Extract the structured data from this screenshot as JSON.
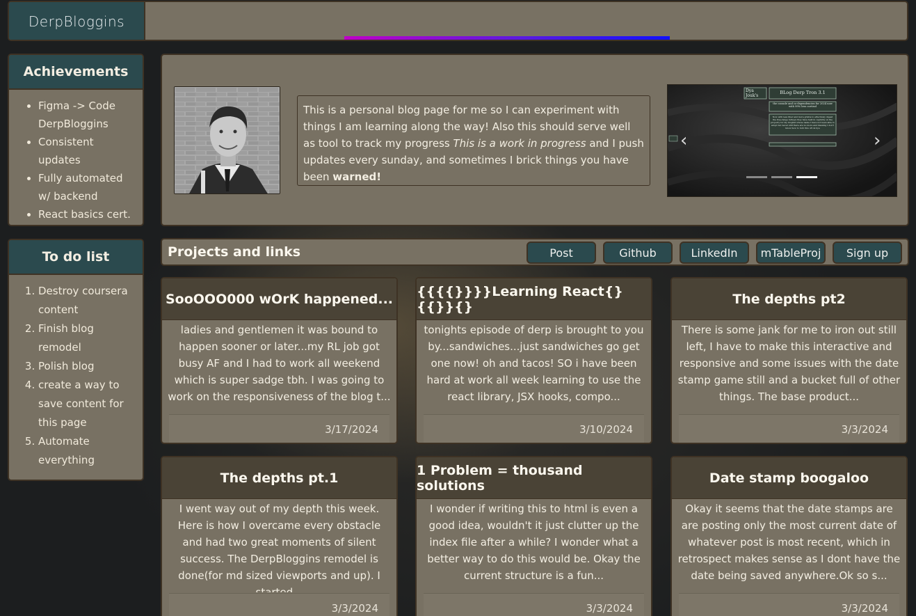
{
  "header": {
    "logo": "DerpBloggins",
    "progress": 1.0,
    "progress_gradient": [
      "#c000c8",
      "#1010ff"
    ]
  },
  "achievements": {
    "title": "Achievements",
    "items": [
      "Figma -> Code DerpBloggins",
      "Consistent updates",
      "Fully automated w/ backend",
      "React basics cert."
    ]
  },
  "todo": {
    "title": "To do list",
    "items": [
      "Destroy coursera content",
      "Finish blog remodel",
      "Polish blog",
      "create a way to save content for this page",
      "Automate everything"
    ]
  },
  "intro": {
    "text_part1": "This is a personal blog page for me so I can experiment with things I am learning along the way! Also this should serve well as tool to track my progress ",
    "text_italic": "This is a work in progress",
    "text_part2": " and I push updates every sunday, and sometimes I brick things you have been ",
    "text_bold": "warned!"
  },
  "carousel": {
    "slide_logo_line1": "Dya",
    "slide_logo_line2": "Jouk's",
    "slide_title": "BLog Derp Tron 3.1",
    "slide_subtitle": "the console and co-dependencies for 2024 now with 99% less cortisol",
    "slide_body": "Now with less fiber and more gristle to effectively digest the free-range turkeys they have held in captivity on the property for my bloglist whose name I have not been able to adopt but never still there are no more and blessing I don't know how to turn this off ok bye",
    "indicators": 3,
    "active_index": 2
  },
  "projects": {
    "title": "Projects and links",
    "nav": [
      "Post",
      "Github",
      "LinkedIn",
      "mTableProj",
      "Sign up"
    ]
  },
  "posts": [
    {
      "title": "SooOOO000 wOrK happened...",
      "excerpt": "ladies and gentlemen it was bound to happen sooner or later...my RL job got busy AF and I had to work all weekend which is super sadge tbh. I was going to work on the responsiveness of the blog t...",
      "date": "3/17/2024"
    },
    {
      "title": "{{{{}}}}Learning React{}{{}}{}",
      "excerpt": "tonights episode of derp is brought to you by...sandwiches...just sandwiches go get one now! oh and tacos! SO i have been hard at work all week learning to use the react library, JSX hooks, compo...",
      "date": "3/10/2024"
    },
    {
      "title": "The depths pt2",
      "excerpt": "There is some jank for me to iron out still left, I have to make this interactive and responsive and some issues with the date stamp game still and a bucket full of other things. The base product...",
      "date": "3/3/2024"
    },
    {
      "title": "The depths pt.1",
      "excerpt": "I went way out of my depth this week. Here is how I overcame every obstacle and had two great moments of silent success. The DerpBloggins remodel is done(for md sized viewports and up). I started...",
      "date": "3/3/2024"
    },
    {
      "title": "1 Problem = thousand solutions",
      "excerpt": "I wonder if writing this to html is even a good idea, wouldn't it just clutter up the index file after a while? I wonder what a better way to do this would be. Okay the current structure is a fun...",
      "date": "3/3/2024"
    },
    {
      "title": "Date stamp boogaloo",
      "excerpt": "Okay it seems that the date stamps are are posting only the most current date of whatever post is most recent, which in retrospect makes sense as I dont have the date being saved anywhere.Ok so s...",
      "date": "3/3/2024"
    }
  ],
  "colors": {
    "accent_teal": "#2b4a4e",
    "panel": "#787163",
    "card_header": "#4a4336",
    "border": "#3e3224"
  }
}
